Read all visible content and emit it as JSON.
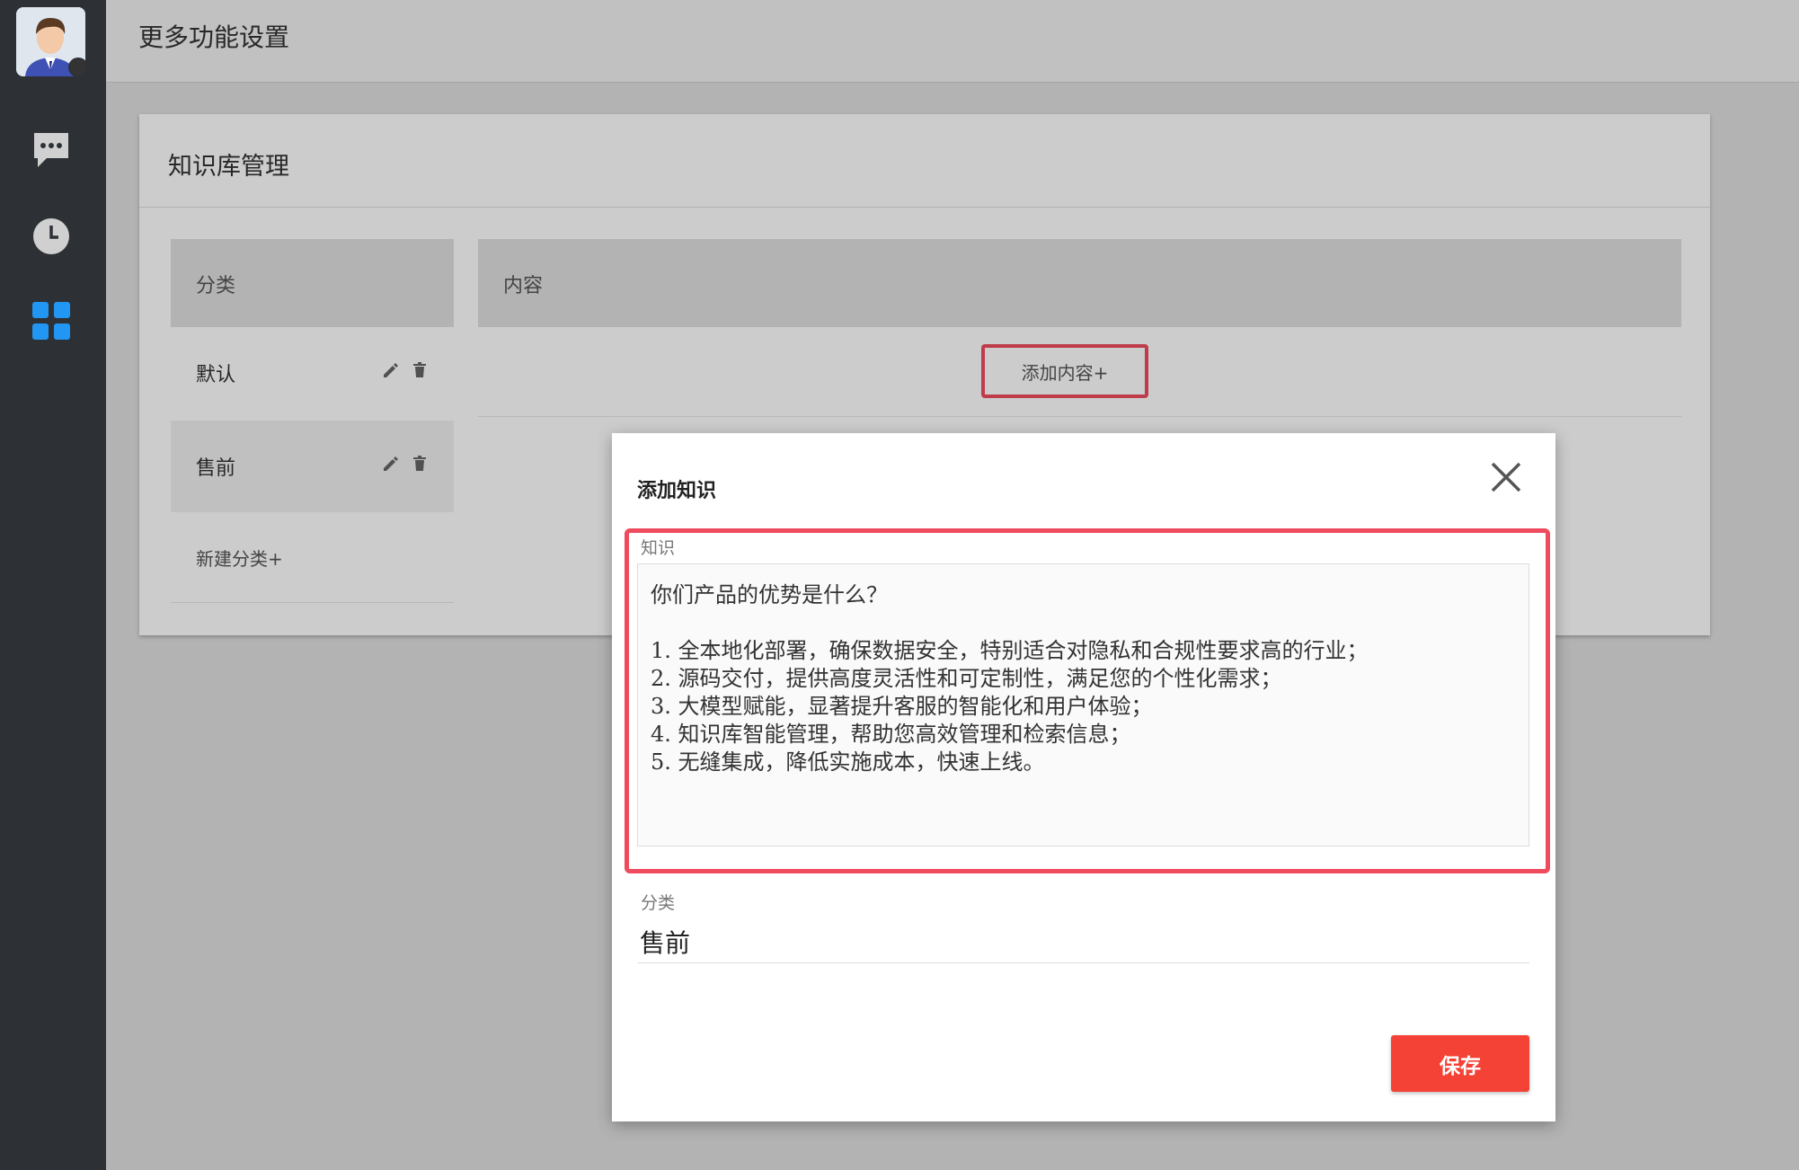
{
  "header": {
    "title": "更多功能设置"
  },
  "sidebar": {
    "items": [
      {
        "icon": "chat-icon"
      },
      {
        "icon": "clock-icon"
      },
      {
        "icon": "apps-grid-icon"
      }
    ],
    "accent": "#2196f3"
  },
  "card": {
    "title": "知识库管理",
    "columns": {
      "category": "分类",
      "content": "内容"
    },
    "categories": [
      {
        "label": "默认",
        "selected": false
      },
      {
        "label": "售前",
        "selected": true
      }
    ],
    "new_category": "新建分类+",
    "add_content": "添加内容+"
  },
  "dialog": {
    "title": "添加知识",
    "knowledge_label": "知识",
    "knowledge_lines": [
      "你们产品的优势是什么？",
      "",
      "1.  全本地化部署，确保数据安全，特别适合对隐私和合规性要求高的行业；",
      "2.  源码交付，提供高度灵活性和可定制性，满足您的个性化需求；",
      "3.  大模型赋能，显著提升客服的智能化和用户体验；",
      "4.  知识库智能管理，帮助您高效管理和检索信息；",
      "5.  无缝集成，降低实施成本，快速上线。"
    ],
    "category_label": "分类",
    "category_value": "售前",
    "save_label": "保存"
  },
  "colors": {
    "highlight": "#ef4b5e",
    "save": "#f44336"
  }
}
